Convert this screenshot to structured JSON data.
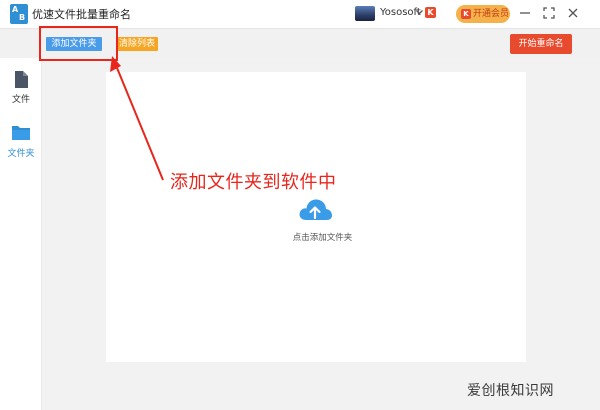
{
  "titlebar": {
    "logo_letters": [
      "A",
      "B"
    ],
    "title": "优速文件批量重命名",
    "user_name": "Yososoft",
    "user_badge": "K",
    "vip_icon": "K",
    "vip_label": "开通会员",
    "minimize_glyph": "—",
    "maximize_glyph": "⛶",
    "close_glyph": "✕"
  },
  "toolbar": {
    "add_folder_label": "添加文件夹",
    "clear_list_label": "清除列表",
    "start_rename_label": "开始重命名"
  },
  "sidebar": {
    "items": [
      {
        "label": "文件",
        "icon": "file-icon",
        "active": false
      },
      {
        "label": "文件夹",
        "icon": "folder-icon",
        "active": true
      }
    ]
  },
  "main": {
    "drop_hint": "点击添加文件夹",
    "upload_icon": "cloud-upload-icon"
  },
  "annotation": {
    "text": "添加文件夹到软件中"
  },
  "watermark": {
    "text": "爱创根知识网"
  },
  "colors": {
    "accent_blue": "#4a9be8",
    "accent_orange": "#f6a623",
    "danger_red": "#e84a2e",
    "annotation_red": "#e8261c"
  }
}
